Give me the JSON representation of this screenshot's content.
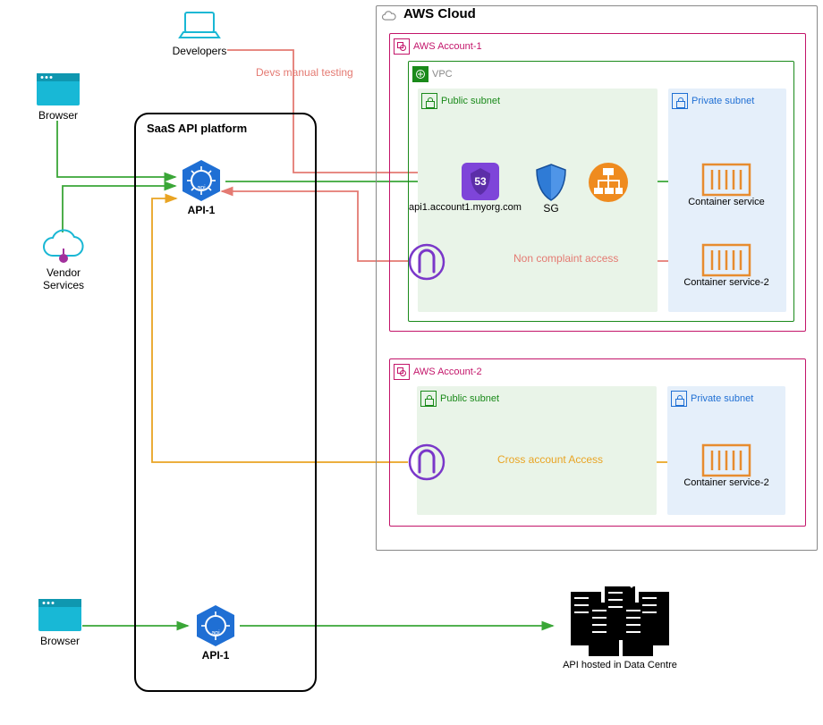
{
  "external": {
    "browser1": "Browser",
    "browser2": "Browser",
    "developers": "Developers",
    "vendor": "Vendor Services"
  },
  "saas": {
    "title": "SaaS API platform",
    "api1_label": "API-1",
    "api2_label": "API-1"
  },
  "cloud": {
    "title": "AWS Cloud",
    "account1": {
      "label": "AWS Account-1",
      "vpc_label": "VPC",
      "public_subnet": "Public subnet",
      "private_subnet": "Private subnet",
      "route53_host": "api1.account1.myorg.com",
      "sg_label": "SG",
      "container1": "Container service",
      "container2": "Container service-2"
    },
    "account2": {
      "label": "AWS Account-2",
      "public_subnet": "Public subnet",
      "private_subnet": "Private subnet",
      "container": "Container service-2"
    }
  },
  "datacenter": {
    "label": "API hosted in Data Centre"
  },
  "flows": {
    "devs_manual": "Devs manual testing",
    "non_compliant": "Non complaint access",
    "cross_account": "Cross account Access"
  },
  "colors": {
    "green_flow": "#3aa637",
    "red_flow": "#e47a72",
    "orange_flow": "#e9a423",
    "account_border": "#c3156a",
    "vpc_border": "#1a8a1a",
    "public_bg": "#e9f4e8",
    "private_bg": "#e5effa"
  }
}
